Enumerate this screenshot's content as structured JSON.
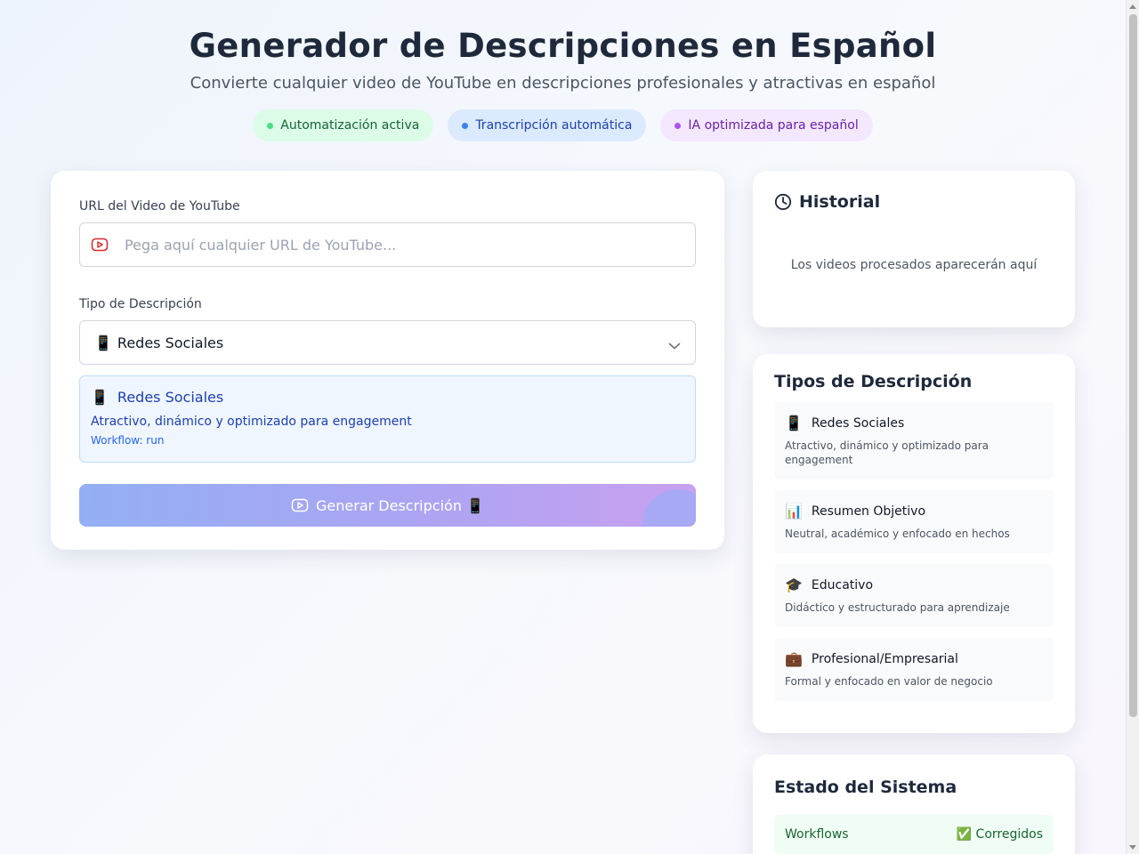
{
  "header": {
    "title": "Generador de Descripciones en Español",
    "subtitle": "Convierte cualquier video de YouTube en descripciones profesionales y atractivas en español"
  },
  "badges": [
    {
      "label": "Automatización activa",
      "color": "#4ade80"
    },
    {
      "label": "Transcripción automática",
      "color": "#3b82f6"
    },
    {
      "label": "IA optimizada para español",
      "color": "#a855f7"
    }
  ],
  "form": {
    "url_label": "URL del Video de YouTube",
    "url_placeholder": "Pega aquí cualquier URL de YouTube...",
    "url_value": "",
    "type_label": "Tipo de Descripción",
    "type_selected": {
      "emoji": "📱",
      "label": "Redes Sociales"
    },
    "info": {
      "emoji": "📱",
      "title": "Redes Sociales",
      "description": "Atractivo, dinámico y optimizado para engagement",
      "workflow": "Workflow: run"
    },
    "generate_label": "Generar Descripción 📱"
  },
  "history": {
    "title": "Historial",
    "empty_text": "Los videos procesados aparecerán aquí"
  },
  "types": {
    "title": "Tipos de Descripción",
    "items": [
      {
        "emoji": "📱",
        "name": "Redes Sociales",
        "description": "Atractivo, dinámico y optimizado para engagement"
      },
      {
        "emoji": "📊",
        "name": "Resumen Objetivo",
        "description": "Neutral, académico y enfocado en hechos"
      },
      {
        "emoji": "🎓",
        "name": "Educativo",
        "description": "Didáctico y estructurado para aprendizaje"
      },
      {
        "emoji": "💼",
        "name": "Profesional/Empresarial",
        "description": "Formal y enfocado en valor de negocio"
      }
    ]
  },
  "status": {
    "title": "Estado del Sistema",
    "rows": [
      {
        "label": "Workflows",
        "value": "✅ Corregidos"
      }
    ]
  },
  "colors": {
    "accent_blue": "#1e40af",
    "button_gradient_start": "#93aff3",
    "button_gradient_end": "#c8a0f1"
  }
}
